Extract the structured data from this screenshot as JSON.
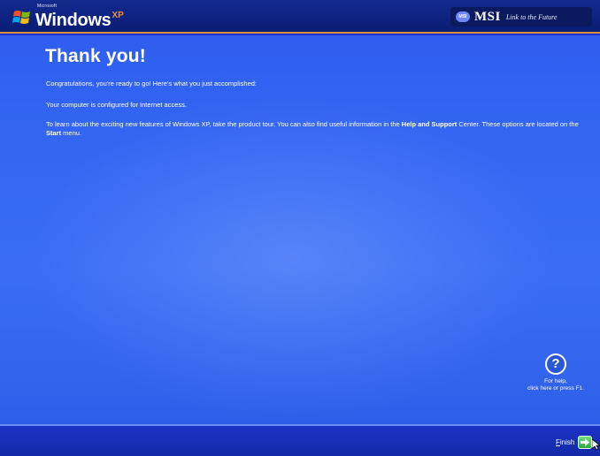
{
  "header": {
    "logo_brand_small": "Microsoft",
    "logo_word": "Windows",
    "logo_suffix": "XP",
    "oem_brand": "MSI",
    "oem_tagline": "Link to the Future",
    "oem_badge": "MSI"
  },
  "main": {
    "title": "Thank you!",
    "line1": "Congratulations, you're ready to go! Here's what you just accomplished:",
    "line2": "Your computer is configured for Internet access.",
    "line3_part1": "To learn about the exciting new features of Windows XP, take the product tour. You can also find useful information in the ",
    "line3_bold1": "Help and Support",
    "line3_part2": " Center. These options are located on the ",
    "line3_bold2": "Start",
    "line3_part3": " menu."
  },
  "help": {
    "icon": "help-icon",
    "line1": "For help,",
    "line2": "click here or press F1."
  },
  "footer": {
    "finish_accel": "F",
    "finish_rest": "inish"
  },
  "colors": {
    "background_blue": "#3466f3",
    "topbar": "#0d2280",
    "topbar_accent": "#d6913a",
    "xp_orange": "#f08e3a",
    "finish_green": "#2fa83f"
  }
}
